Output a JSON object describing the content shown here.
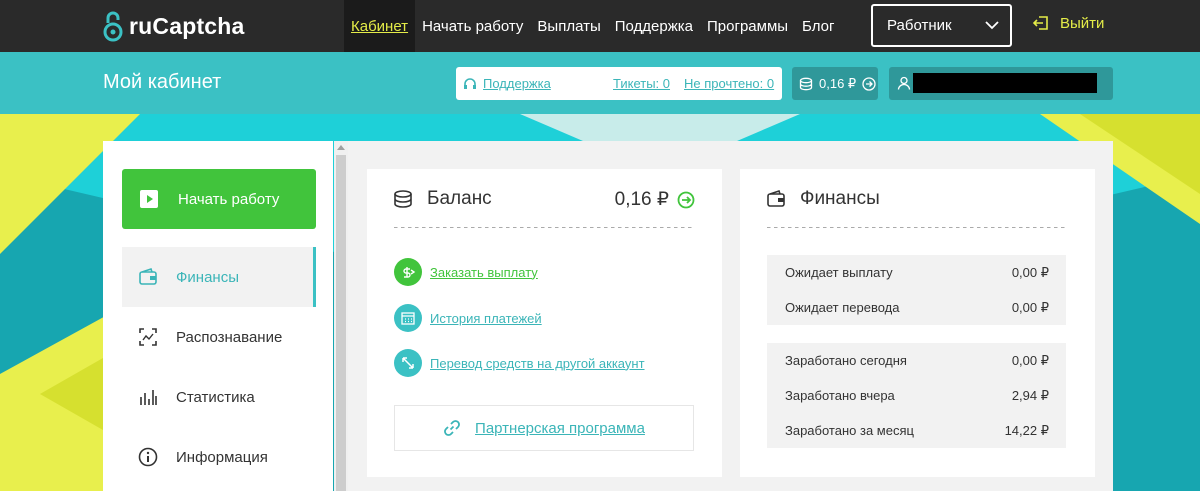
{
  "brand": {
    "name": "ruCaptcha"
  },
  "nav": {
    "items": [
      "Кабинет",
      "Начать работу",
      "Выплаты",
      "Поддержка",
      "Программы",
      "Блог"
    ],
    "active_index": 0,
    "role_select": "Работник",
    "logout": "Выйти"
  },
  "subheader": {
    "title": "Мой кабинет",
    "support": "Поддержка",
    "tickets": "Тикеты: 0",
    "unread": "Не прочтено: 0",
    "balance": "0,16 ₽"
  },
  "sidebar": {
    "start_button": "Начать работу",
    "items": [
      {
        "label": "Финансы",
        "icon": "wallet-icon",
        "active": true
      },
      {
        "label": "Распознавание",
        "icon": "scan-icon",
        "active": false
      },
      {
        "label": "Статистика",
        "icon": "bars-icon",
        "active": false
      },
      {
        "label": "Информация",
        "icon": "info-icon",
        "active": false
      }
    ]
  },
  "balance_card": {
    "title": "Баланс",
    "amount": "0,16 ₽",
    "actions": [
      {
        "label": "Заказать выплату",
        "icon": "dollar-icon",
        "color": "#41c43c"
      },
      {
        "label": "История платежей",
        "icon": "calendar-icon",
        "color": "#3bc1c4"
      },
      {
        "label": "Перевод средств на другой аккаунт",
        "icon": "transfer-icon",
        "color": "#3bc1c4"
      }
    ],
    "partner": "Партнерская программа"
  },
  "finance_card": {
    "title": "Финансы",
    "group1": [
      {
        "label": "Ожидает выплату",
        "value": "0,00 ₽"
      },
      {
        "label": "Ожидает перевода",
        "value": "0,00 ₽"
      }
    ],
    "group2": [
      {
        "label": "Заработано сегодня",
        "value": "0,00 ₽"
      },
      {
        "label": "Заработано вчера",
        "value": "2,94 ₽"
      },
      {
        "label": "Заработано за месяц",
        "value": "14,22 ₽"
      }
    ]
  },
  "colors": {
    "topbar": "#2a2a2a",
    "teal": "#3bc1c4",
    "green": "#41c43c",
    "yellow": "#e4ec48"
  }
}
